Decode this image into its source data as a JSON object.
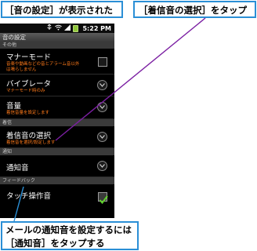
{
  "callouts": {
    "top_left": "［音の設定］が表示された",
    "top_right": "［着信音の選択］をタップ",
    "bottom_line1": "メールの通知音を設定するには",
    "bottom_line2": "［通知音］をタップする"
  },
  "statusbar": {
    "time": "5:22 PM",
    "icons": [
      "usb-icon",
      "wifi-icon",
      "signal-icon",
      "battery-icon"
    ]
  },
  "screen": {
    "title": "音の設定",
    "sections": {
      "other": "その他",
      "ringtone": "着信",
      "notification": "通知",
      "feedback": "フィードバック"
    },
    "rows": {
      "manner": {
        "label": "マナーモード",
        "sub1": "音楽や動画などの音とアラーム音以外",
        "sub2": "は鳴らしません",
        "checked": false
      },
      "vibrate": {
        "label": "バイブレータ",
        "sub": "マナーモード時のみ"
      },
      "volume": {
        "label": "音量",
        "sub": "着信音量を設定します"
      },
      "ringtone": {
        "label": "着信音の選択",
        "sub": "着信音を選択/設定します"
      },
      "notify": {
        "label": "通知音"
      },
      "touch": {
        "label": "タッチ操作音",
        "checked": true
      }
    }
  },
  "colors": {
    "callout_border": "#2b8fd6",
    "arrow": "#7b1fa2",
    "subtext": "#ff7a1a",
    "check": "#5ed12a"
  }
}
